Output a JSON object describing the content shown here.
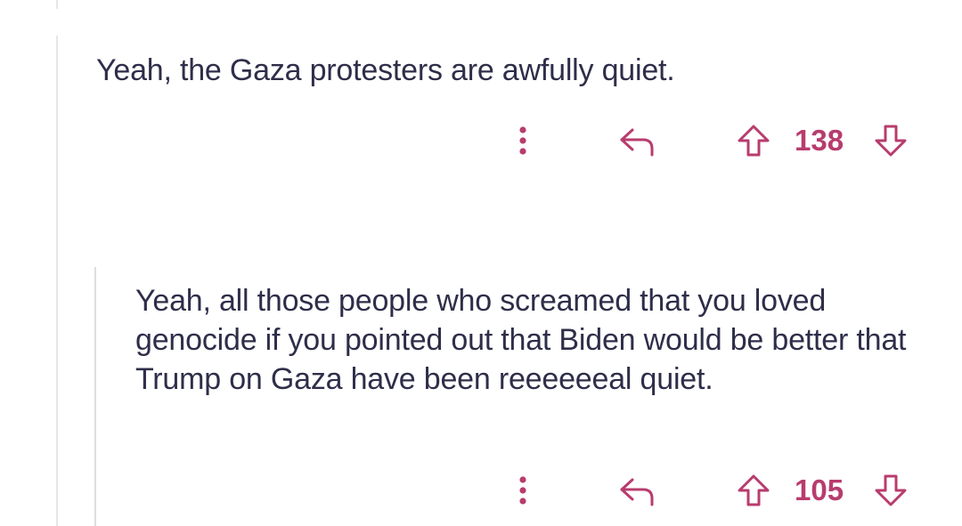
{
  "comments": [
    {
      "text": "Yeah, the Gaza protesters are awfully quiet.",
      "score": "138"
    },
    {
      "text": "Yeah, all those people who screamed that you loved genocide if you pointed out that Biden would be better that Trump on Gaza have been reeeeeeal quiet.",
      "score": "105"
    }
  ],
  "icons": {
    "more": "more-vertical-icon",
    "reply": "reply-icon",
    "upvote": "upvote-arrow-icon",
    "downvote": "downvote-arrow-icon"
  },
  "colors": {
    "accent": "#b83c6e",
    "text": "#2e2e4a",
    "thread_line": "#e6e6ea"
  }
}
